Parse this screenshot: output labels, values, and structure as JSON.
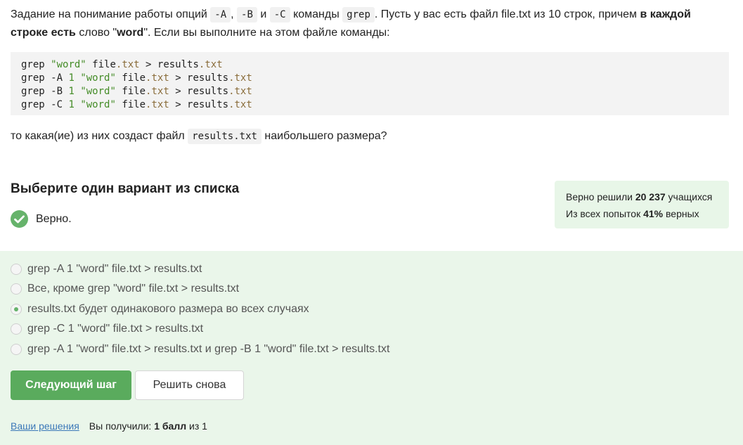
{
  "question": {
    "p1_a": "Задание на понимание работы опций",
    "opt_a": "-A",
    "comma": ",",
    "opt_b": "-B",
    "and": "и",
    "opt_c": "-C",
    "p1_b": "команды",
    "grep": "grep",
    "p1_c": ". Пусть у вас есть файл file.txt из 10 строк, причем",
    "bold1": "в каждой строке есть",
    "p1_d": "слово \"",
    "bold2": "word",
    "p1_e": "\". Если вы выполните на этом файле команды:"
  },
  "code_lines": [
    "grep \"word\" file.txt > results.txt",
    "grep -A 1 \"word\" file.txt > results.txt",
    "grep -B 1 \"word\" file.txt > results.txt",
    "grep -C 1 \"word\" file.txt > results.txt"
  ],
  "question2": {
    "a": "то какая(ие) из них создаст файл",
    "code": "results.txt",
    "b": "наибольшего размера?"
  },
  "choose_title": "Выберите один вариант из списка",
  "verdict": "Верно.",
  "stats": {
    "l1_a": "Верно решили",
    "l1_b": "20 237",
    "l1_c": "учащихся",
    "l2_a": "Из всех попыток",
    "l2_b": "41%",
    "l2_c": "верных"
  },
  "options": [
    {
      "label": "grep -A 1 \"word\" file.txt > results.txt",
      "checked": false
    },
    {
      "label": "Все, кроме grep \"word\" file.txt > results.txt",
      "checked": false
    },
    {
      "label": "results.txt будет одинакового размера во всех случаях",
      "checked": true
    },
    {
      "label": "grep -C 1 \"word\" file.txt > results.txt",
      "checked": false
    },
    {
      "label": "grep -A 1 \"word\" file.txt > results.txt и grep -B 1 \"word\" file.txt > results.txt",
      "checked": false
    }
  ],
  "buttons": {
    "next": "Следующий шаг",
    "retry": "Решить снова"
  },
  "footer": {
    "link": "Ваши решения",
    "a": "Вы получили:",
    "b": "1 балл",
    "c": "из 1"
  },
  "colors": {
    "accent_green": "#5aab5d",
    "answers_bg": "#eaf6ea",
    "stats_bg": "#e8f6e8",
    "link": "#3b78b8"
  }
}
